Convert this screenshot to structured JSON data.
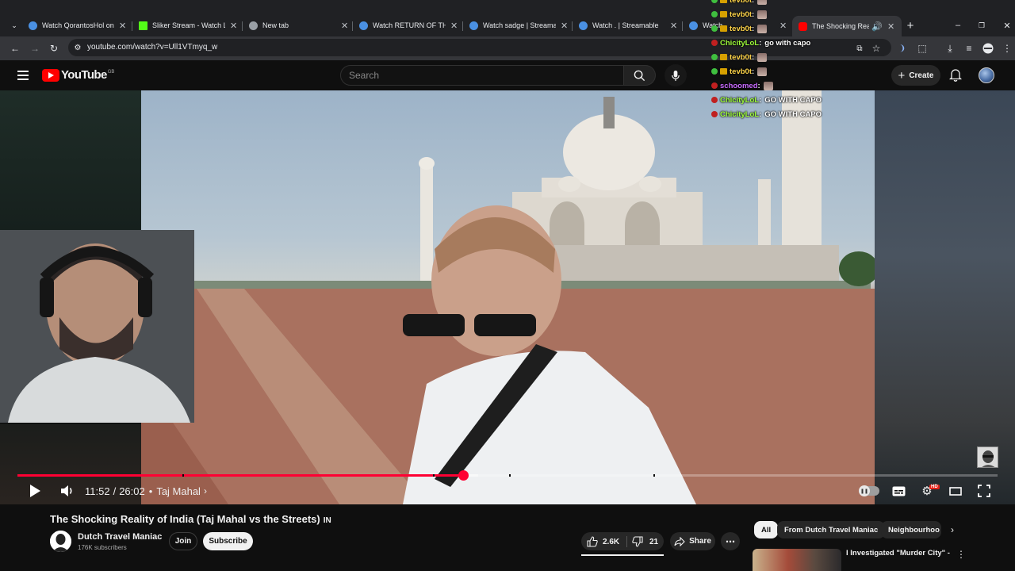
{
  "browser": {
    "tabs": [
      {
        "label": "Watch QorantosHol on cl",
        "favicon": "#4a90e2"
      },
      {
        "label": "Sliker Stream - Watch Live",
        "favicon": "#53fc18"
      },
      {
        "label": "New tab",
        "favicon": "#9aa0a6"
      },
      {
        "label": "Watch RETURN OF THE G",
        "favicon": "#4a90e2"
      },
      {
        "label": "Watch sadge | Streamable",
        "favicon": "#4a90e2"
      },
      {
        "label": "Watch . | Streamable",
        "favicon": "#4a90e2"
      },
      {
        "label": "Watch",
        "favicon": "#4a90e2"
      },
      {
        "label": "The Shocking Reality",
        "favicon": "#ff0000",
        "active": true
      }
    ],
    "url": "youtube.com/watch?v=Ull1VTmyq_w"
  },
  "youtube": {
    "logo_text": "YouTube",
    "country_code": "GB",
    "search_placeholder": "Search",
    "create_label": "Create"
  },
  "chat": [
    {
      "user": "tevb0t",
      "color": "#ffd54a",
      "badges": [
        "green",
        "gold"
      ],
      "message": "",
      "emote": true
    },
    {
      "user": "tevb0t",
      "color": "#ffd54a",
      "badges": [
        "green",
        "gold"
      ],
      "message": "",
      "emote": true
    },
    {
      "user": "tevb0t",
      "color": "#ffd54a",
      "badges": [
        "green",
        "gold"
      ],
      "message": "",
      "emote": true
    },
    {
      "user": "ChicityLoL",
      "color": "#9fff3a",
      "badges": [
        "red"
      ],
      "message": "go with capo",
      "emote": false
    },
    {
      "user": "tevb0t",
      "color": "#ffd54a",
      "badges": [
        "green",
        "gold"
      ],
      "message": "",
      "emote": true
    },
    {
      "user": "tevb0t",
      "color": "#ffd54a",
      "badges": [
        "green",
        "gold"
      ],
      "message": "",
      "emote": true
    },
    {
      "user": "schoomed",
      "color": "#c86bff",
      "badges": [
        "red"
      ],
      "message": "",
      "emote": true
    },
    {
      "user": "ChicityLoL",
      "color": "#9fff3a",
      "badges": [
        "red"
      ],
      "message": "GO WITH CAPO",
      "emote": false
    },
    {
      "user": "ChicityLoL",
      "color": "#9fff3a",
      "badges": [
        "red"
      ],
      "message": "GO WITH CAPO",
      "emote": false
    }
  ],
  "player": {
    "current_time": "11:52",
    "duration": "26:02",
    "time_separator": "/",
    "chapter_separator": "•",
    "chapter": "Taj Mahal",
    "chapter_arrow": "›",
    "played_fraction": 0.455,
    "loaded_fraction": 0.47,
    "hd_label": "HD"
  },
  "video": {
    "title": "The Shocking Reality of India (Taj Mahal vs the Streets)",
    "title_suffix": "IN",
    "channel": "Dutch Travel Maniac",
    "subscribers": "176K subscribers",
    "join_label": "Join",
    "subscribe_label": "Subscribe",
    "likes": "2.6K",
    "dislikes": "21",
    "share_label": "Share"
  },
  "sidebar": {
    "chips": [
      "All",
      "From Dutch Travel Maniac",
      "Neighbourhoo"
    ],
    "recommendation_title": "I Investigated \"Murder City\" -"
  },
  "colors": {
    "accent": "#ff0033",
    "yt_red": "#ff0000",
    "background": "#0f0f0f"
  }
}
